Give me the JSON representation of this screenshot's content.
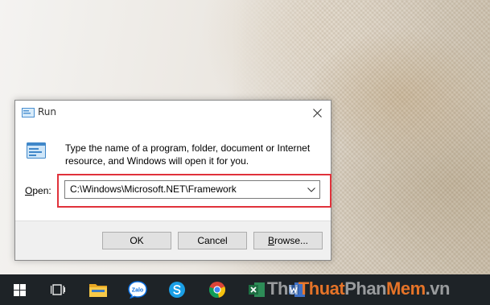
{
  "dialog": {
    "title": "Run",
    "description": "Type the name of a program, folder, document or Internet resource, and Windows will open it for you.",
    "open_label_accel": "O",
    "open_label_rest": "pen:",
    "open_value": "C:\\Windows\\Microsoft.NET\\Framework",
    "buttons": {
      "ok": "OK",
      "cancel": "Cancel",
      "browse_accel": "B",
      "browse_rest": "rowse..."
    },
    "highlight_color": "#e0323b"
  },
  "taskbar": {
    "items": [
      {
        "icon": "windows-start-icon"
      },
      {
        "icon": "task-view-icon"
      },
      {
        "icon": "file-explorer-icon"
      },
      {
        "icon": "zalo-icon",
        "label": "Zalo"
      },
      {
        "icon": "skype-icon"
      },
      {
        "icon": "chrome-icon"
      },
      {
        "icon": "excel-icon"
      },
      {
        "icon": "word-icon"
      }
    ],
    "zalo_label": "Zalo"
  },
  "watermark": {
    "part1": "Thu",
    "part2": "Thuat",
    "part3": "Phan",
    "part4": "Mem",
    "part5": ".vn"
  },
  "colors": {
    "taskbar_bg": "#1e2327",
    "dialog_footer": "#f0f0f0",
    "active_indicator": "#76b9ed"
  }
}
